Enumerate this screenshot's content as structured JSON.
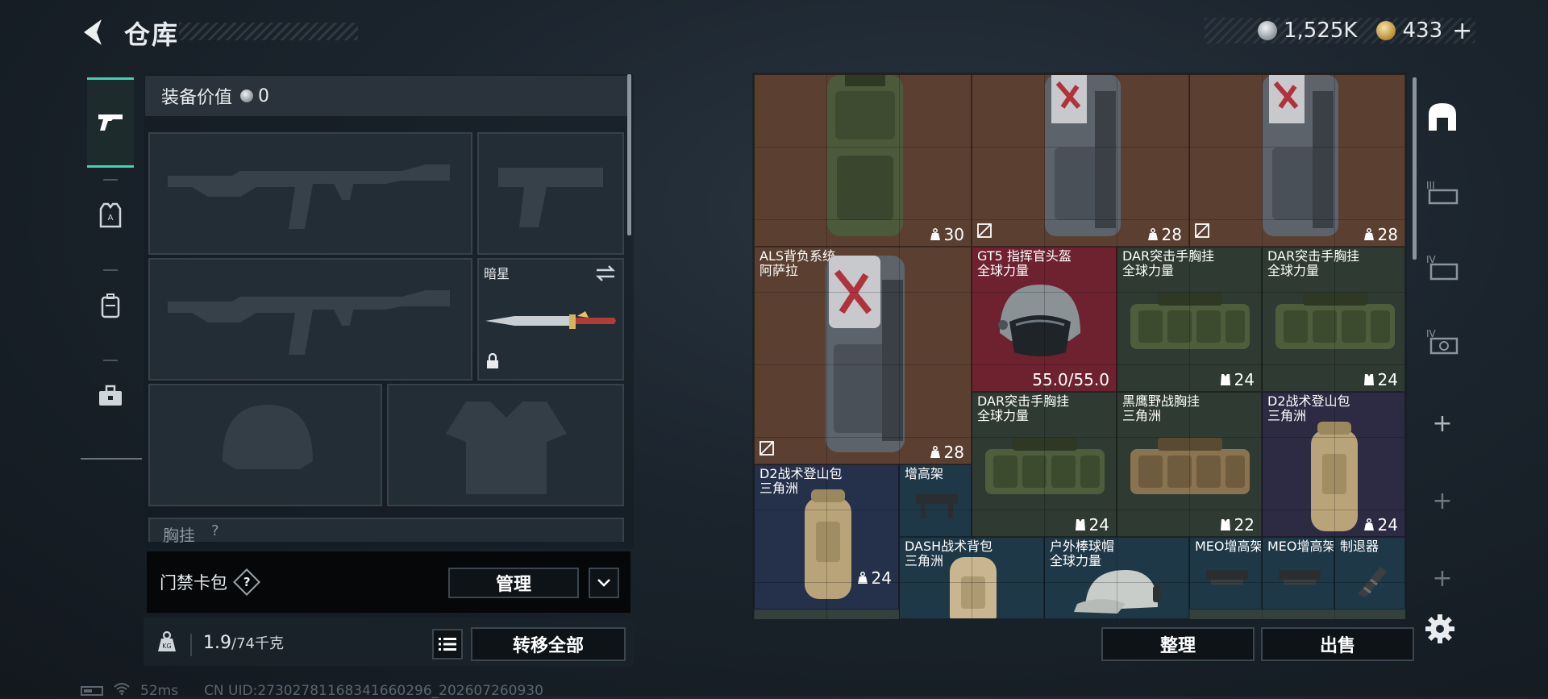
{
  "header": {
    "title": "仓库",
    "currency_silver": "1,525K",
    "currency_gold": "433",
    "currency_plus": "+"
  },
  "left_nav": {
    "items": [
      {
        "icon": "pistol-icon",
        "active": true
      },
      {
        "icon": "armor-vest-icon",
        "active": false
      },
      {
        "icon": "backpack-icon",
        "active": false
      },
      {
        "icon": "toolbox-icon",
        "active": false
      }
    ]
  },
  "loadout": {
    "value_label": "装备价值",
    "value_amount": "0",
    "melee_label": "暗星",
    "chest_partial_label": "胸挂",
    "chest_help": "?",
    "keycard_label": "门禁卡包",
    "keycard_help": "?",
    "manage_button": "管理",
    "weight_current": "1.9",
    "weight_max": "/74千克",
    "transfer_all_button": "转移全部"
  },
  "status_bar": {
    "ping": "52ms",
    "uid": "CN UID:27302781168341660296_202607260930"
  },
  "grid_items": [
    {
      "name": "",
      "stat": "30",
      "stat_icon": "weight-icon",
      "no_icon": false
    },
    {
      "name": "",
      "stat": "28",
      "stat_icon": "weight-icon",
      "no_icon": true
    },
    {
      "name": "",
      "stat": "28",
      "stat_icon": "weight-icon",
      "no_icon": true
    },
    {
      "name": "ALS背负系统\n阿萨拉",
      "stat": "28",
      "stat_icon": "weight-icon",
      "no_icon": true
    },
    {
      "name": "GT5 指挥官头盔\n全球力量",
      "stat": "55.0/55.0",
      "stat_icon": "",
      "no_icon": false
    },
    {
      "name": "DAR突击手胸挂\n全球力量",
      "stat": "24",
      "stat_icon": "vest-icon",
      "no_icon": false
    },
    {
      "name": "DAR突击手胸挂\n全球力量",
      "stat": "24",
      "stat_icon": "vest-icon",
      "no_icon": false
    },
    {
      "name": "DAR突击手胸挂\n全球力量",
      "stat": "24",
      "stat_icon": "vest-icon",
      "no_icon": false
    },
    {
      "name": "黑鹰野战胸挂\n三角洲",
      "stat": "22",
      "stat_icon": "vest-icon",
      "no_icon": false
    },
    {
      "name": "D2战术登山包\n三角洲",
      "stat": "24",
      "stat_icon": "weight-icon",
      "no_icon": false
    },
    {
      "name": "D2战术登山包\n三角洲",
      "stat": "24",
      "stat_icon": "weight-icon",
      "no_icon": false
    },
    {
      "name": "增高架",
      "stat": "",
      "stat_icon": "",
      "no_icon": false
    },
    {
      "name": "DASH战术背包\n三角洲",
      "stat": "",
      "stat_icon": "",
      "no_icon": false
    },
    {
      "name": "户外棒球帽\n全球力量",
      "stat": "",
      "stat_icon": "",
      "no_icon": false
    },
    {
      "name": "MEO增高架",
      "stat": "",
      "stat_icon": "",
      "no_icon": false
    },
    {
      "name": "MEO增高架",
      "stat": "",
      "stat_icon": "",
      "no_icon": false
    },
    {
      "name": "制退器",
      "stat": "",
      "stat_icon": "",
      "no_icon": false
    }
  ],
  "right_sidebar": {
    "tabs": [
      "stash-home-icon",
      "stash-tab-III-icon",
      "stash-tab-IV-icon",
      "stash-tab-IV-alt-icon"
    ],
    "plus": "+"
  },
  "bottom_actions": {
    "organize_button": "整理",
    "sell_button": "出售"
  },
  "colors": {
    "accent": "#3fd2b3",
    "brown_cell": "#5b4032",
    "red_cell": "#6e2230"
  }
}
